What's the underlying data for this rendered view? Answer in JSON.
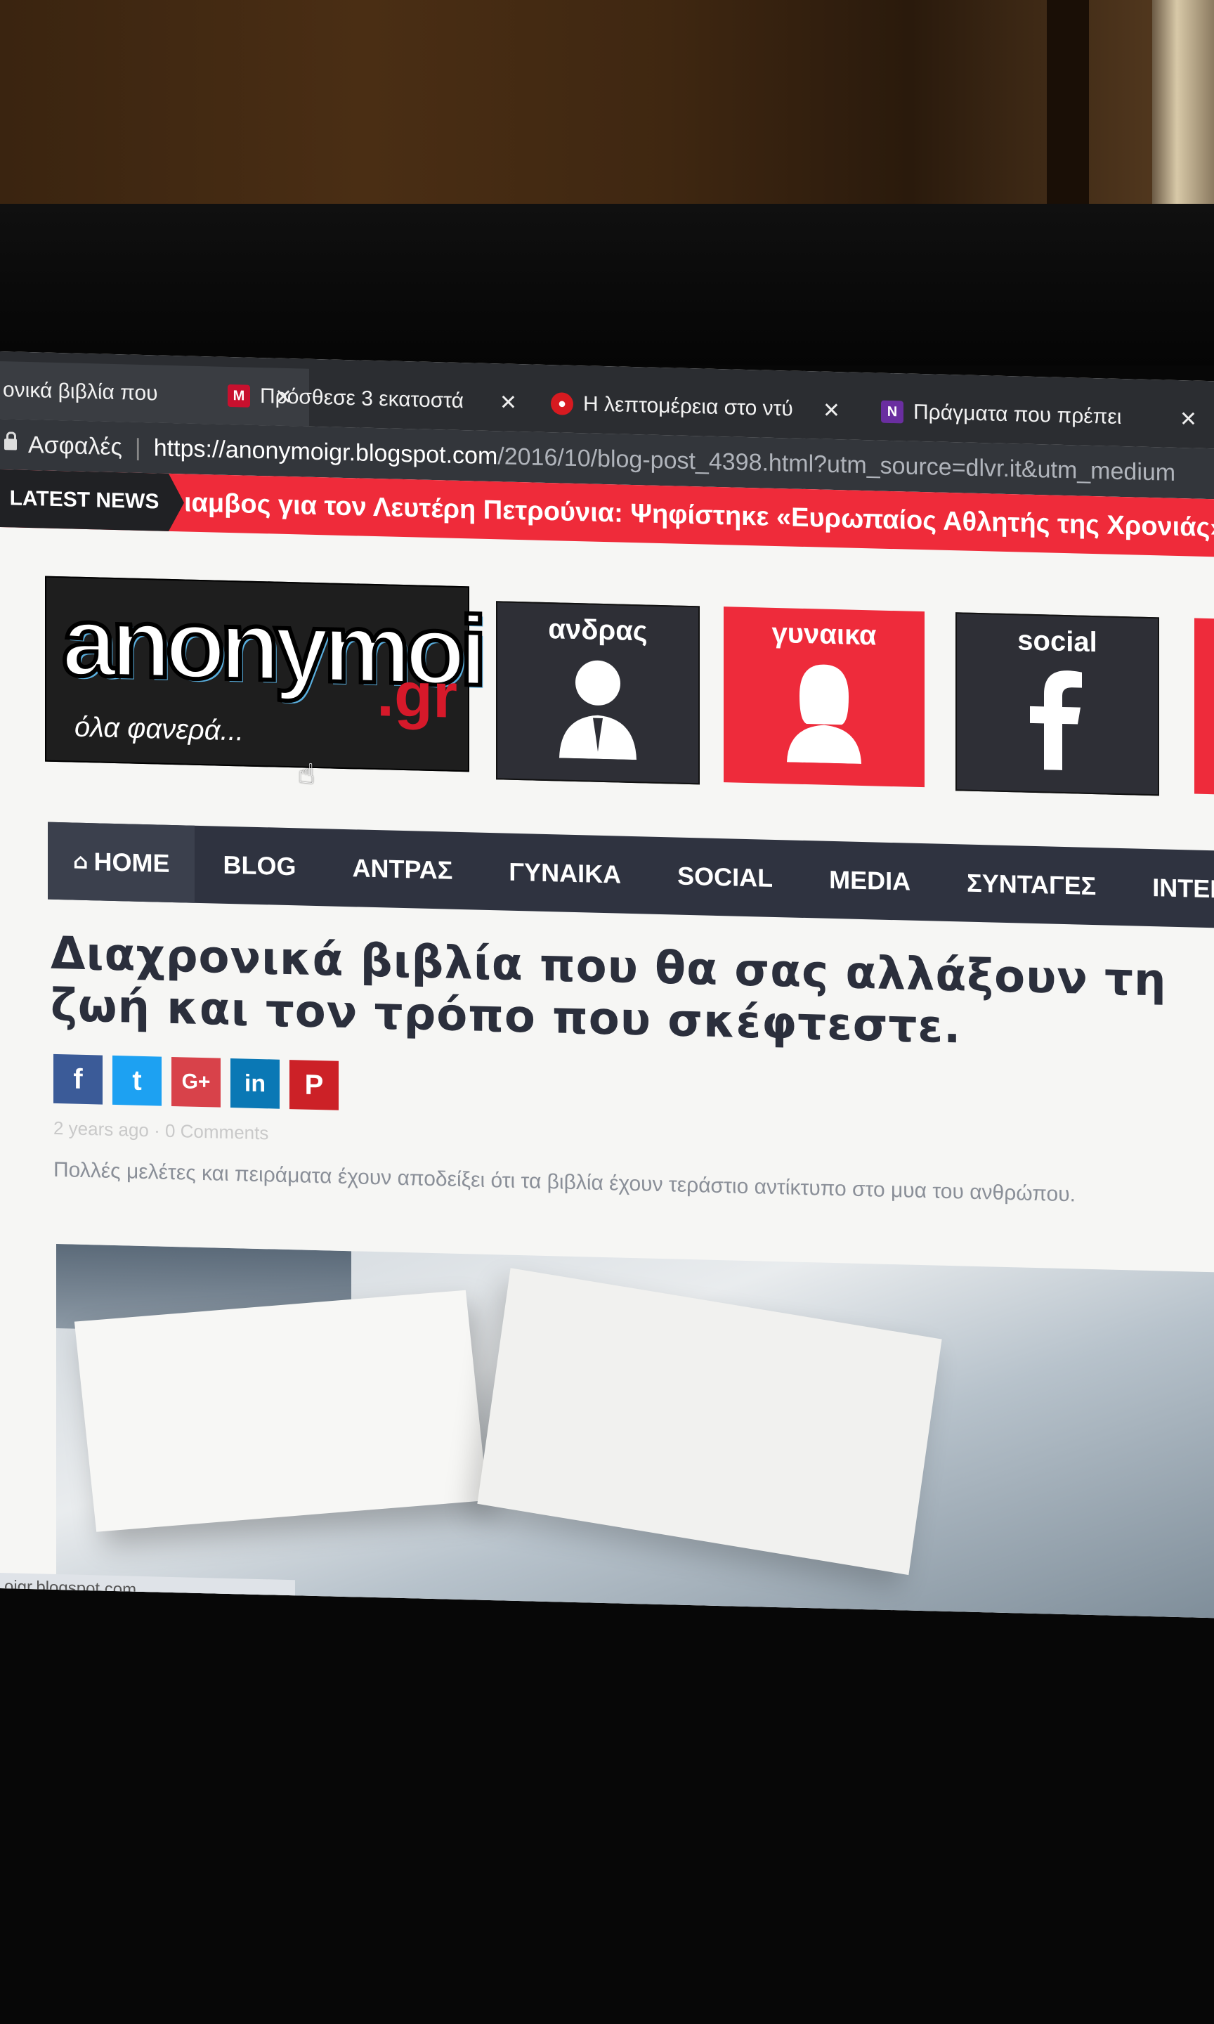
{
  "browser": {
    "tabs": [
      {
        "title": "ονικά βιβλία που",
        "favicon": "",
        "active": true
      },
      {
        "title": "Πρόσθεσε 3 εκατοστά",
        "favicon": "magazine-icon",
        "active": false
      },
      {
        "title": "Η λεπτομέρεια στο ντύ",
        "favicon": "circle-logo-icon",
        "active": false
      },
      {
        "title": "Πράγματα που πρέπει",
        "favicon": "N",
        "active": false
      }
    ],
    "tab_close": "✕",
    "security_label": "Ασφαλές",
    "url_host": "https://anonymoigr.blogspot.com",
    "url_path": "/2016/10/blog-post_4398.html?utm_source=dlvr.it&utm_medium"
  },
  "ticker": {
    "label": "LATEST NEWS",
    "text": "ιαμβος για τον Λευτέρη Πετρούνια: Ψηφίστηκε «Ευρωπαίος Αθλητής της Χρονιάς»"
  },
  "header": {
    "logo_text": "anonymoi",
    "logo_domain": ".gr",
    "logo_tagline": "όλα φανερά...",
    "categories": [
      {
        "label": "ανδρας",
        "icon": "man-icon"
      },
      {
        "label": "γυναικα",
        "icon": "woman-icon"
      },
      {
        "label": "social",
        "icon": "facebook-icon"
      }
    ]
  },
  "nav": {
    "items": [
      "HOME",
      "BLOG",
      "ΑΝΤΡΑΣ",
      "ΓΥΝΑΙΚΑ",
      "SOCIAL",
      "MEDIA",
      "ΣΥΝΤΑΓΕΣ",
      "INTERNET"
    ]
  },
  "article": {
    "title": "Διαχρονικά βιβλία που θα σας αλλάξουν τη ζωή και τον τρόπο που σκέφτεστε.",
    "share": [
      "f",
      "t",
      "G+",
      "in",
      "P"
    ],
    "meta": "2 years ago · 0 Comments",
    "excerpt": "Πολλές μελέτες και πειράματα έχουν αποδείξει ότι τα βιβλία έχουν τεράστιο αντίκτυπο στο μυα του ανθρώπου."
  },
  "status_url": "oigr.blogspot.com",
  "colors": {
    "accent_red": "#ef2b3a",
    "nav_bg": "#2f3340",
    "taskbar": "#1d3558"
  }
}
